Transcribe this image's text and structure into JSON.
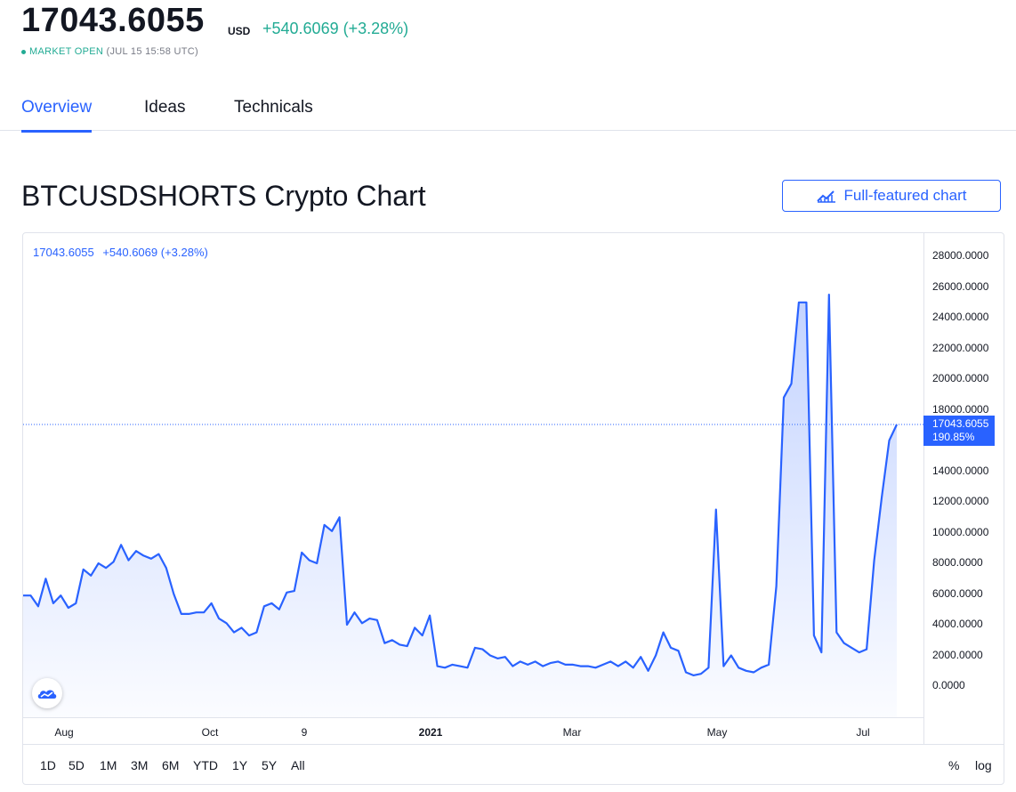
{
  "header": {
    "price": "17043.6055",
    "currency": "USD",
    "change": "+540.6069 (+3.28%)",
    "market_status": "MARKET OPEN",
    "market_time": "(JUL 15 15:58 UTC)"
  },
  "tabs": [
    {
      "label": "Overview",
      "active": true
    },
    {
      "label": "Ideas",
      "active": false
    },
    {
      "label": "Technicals",
      "active": false
    }
  ],
  "section": {
    "title": "BTCUSDSHORTS Crypto Chart",
    "full_chart_button": "Full-featured chart"
  },
  "chart": {
    "legend_value": "17043.6055",
    "legend_change": "+540.6069 (+3.28%)",
    "price_label_value": "17043.6055",
    "price_label_pct": "190.85%",
    "ranges": [
      "1D",
      "5D",
      "1M",
      "3M",
      "6M",
      "YTD",
      "1Y",
      "5Y",
      "All"
    ],
    "percent_toggle": "%",
    "log_toggle": "log",
    "accent_color": "#2962ff"
  },
  "chart_data": {
    "type": "area",
    "title": "",
    "xlabel": "",
    "ylabel": "",
    "ylim": [
      -1000,
      29000
    ],
    "yticks": [
      "28000.0000",
      "26000.0000",
      "24000.0000",
      "22000.0000",
      "20000.0000",
      "18000.0000",
      "14000.0000",
      "12000.0000",
      "10000.0000",
      "8000.0000",
      "6000.0000",
      "4000.0000",
      "2000.0000",
      "0.0000"
    ],
    "xticks": [
      {
        "label": "Aug",
        "bold": false
      },
      {
        "label": "Oct",
        "bold": false
      },
      {
        "label": "9",
        "bold": false
      },
      {
        "label": "2021",
        "bold": true
      },
      {
        "label": "Mar",
        "bold": false
      },
      {
        "label": "May",
        "bold": false
      },
      {
        "label": "Jul",
        "bold": false
      }
    ],
    "last_value": 17043.6055,
    "series": [
      {
        "values": [
          5900,
          5900,
          5200,
          7000,
          5400,
          5900,
          5100,
          5400,
          7600,
          7200,
          8000,
          7700,
          8100,
          9200,
          8200,
          8800,
          8500,
          8300,
          8600,
          7700,
          6000,
          4700,
          4700,
          4800,
          4800,
          5400,
          4400,
          4100,
          3500,
          3800,
          3300,
          3500,
          5200,
          5400,
          5000,
          6100,
          6200,
          8700,
          8200,
          8000,
          10500,
          10100,
          11000,
          4000,
          4800,
          4100,
          4400,
          4300,
          2800,
          3000,
          2700,
          2600,
          3800,
          3300,
          4600,
          1300,
          1200,
          1400,
          1300,
          1200,
          2500,
          2400,
          2000,
          1800,
          1900,
          1300,
          1600,
          1400,
          1600,
          1300,
          1500,
          1600,
          1400,
          1400,
          1300,
          1300,
          1200,
          1400,
          1600,
          1300,
          1600,
          1200,
          1900,
          1000,
          2000,
          3500,
          2500,
          2300,
          900,
          700,
          800,
          1200,
          11500,
          1300,
          2000,
          1200,
          1000,
          900,
          1200,
          1400,
          6500,
          18800,
          19700,
          25000,
          25000,
          3300,
          2200,
          25500,
          3500,
          2800,
          2500,
          2200,
          2400,
          8200,
          12300,
          16000,
          17043
        ]
      }
    ]
  }
}
